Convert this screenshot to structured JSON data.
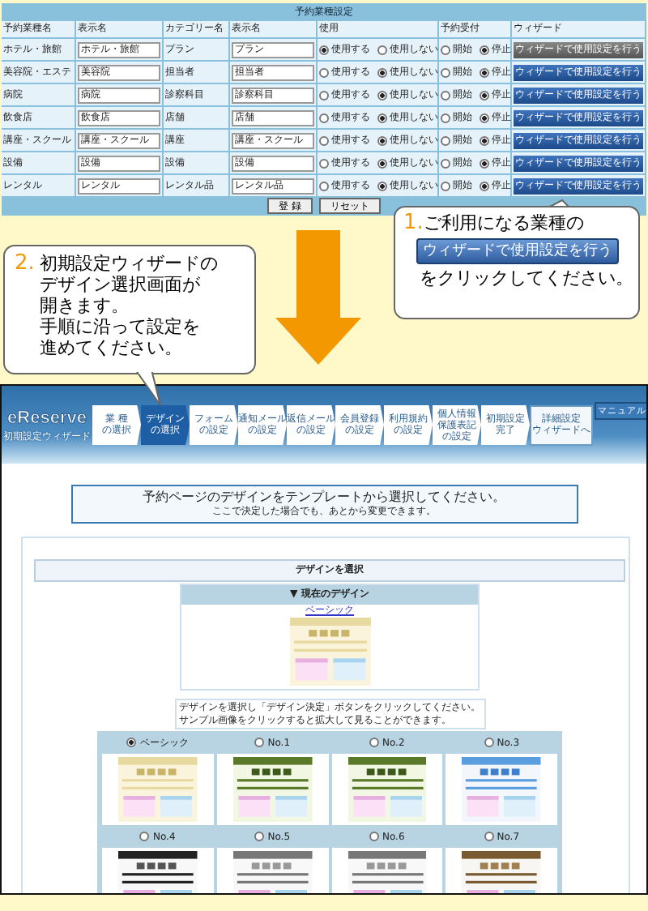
{
  "settings_table": {
    "title": "予約業種設定",
    "columns": [
      "予約業種名",
      "表示名",
      "カテゴリー名",
      "表示名",
      "使用",
      "予約受付",
      "ウィザード"
    ],
    "rows": [
      {
        "name": "ホテル・旅館",
        "display": "ホテル・旅館",
        "category": "プラン",
        "category_display": "プラン",
        "use": [
          {
            "label": "使用する",
            "selected": true
          },
          {
            "label": "使用しない",
            "selected": false
          }
        ],
        "accept": [
          {
            "label": "開始",
            "selected": false
          },
          {
            "label": "停止",
            "selected": true
          }
        ],
        "wizard": {
          "label": "ウィザードで使用設定を行う",
          "disabled": true
        }
      },
      {
        "name": "美容院・エステ",
        "display": "美容院",
        "category": "担当者",
        "category_display": "担当者",
        "use": [
          {
            "label": "使用する",
            "selected": false
          },
          {
            "label": "使用しない",
            "selected": true
          }
        ],
        "accept": [
          {
            "label": "開始",
            "selected": false
          },
          {
            "label": "停止",
            "selected": true
          }
        ],
        "wizard": {
          "label": "ウィザードで使用設定を行う",
          "disabled": false
        }
      },
      {
        "name": "病院",
        "display": "病院",
        "category": "診察科目",
        "category_display": "診察科目",
        "use": [
          {
            "label": "使用する",
            "selected": false
          },
          {
            "label": "使用しない",
            "selected": true
          }
        ],
        "accept": [
          {
            "label": "開始",
            "selected": false
          },
          {
            "label": "停止",
            "selected": true
          }
        ],
        "wizard": {
          "label": "ウィザードで使用設定を行う",
          "disabled": false
        }
      },
      {
        "name": "飲食店",
        "display": "飲食店",
        "category": "店舗",
        "category_display": "店舗",
        "use": [
          {
            "label": "使用する",
            "selected": false
          },
          {
            "label": "使用しない",
            "selected": true
          }
        ],
        "accept": [
          {
            "label": "開始",
            "selected": false
          },
          {
            "label": "停止",
            "selected": true
          }
        ],
        "wizard": {
          "label": "ウィザードで使用設定を行う",
          "disabled": false
        }
      },
      {
        "name": "講座・スクール",
        "display": "講座・スクール",
        "category": "講座",
        "category_display": "講座・スクール",
        "use": [
          {
            "label": "使用する",
            "selected": false
          },
          {
            "label": "使用しない",
            "selected": true
          }
        ],
        "accept": [
          {
            "label": "開始",
            "selected": false
          },
          {
            "label": "停止",
            "selected": true
          }
        ],
        "wizard": {
          "label": "ウィザードで使用設定を行う",
          "disabled": false
        }
      },
      {
        "name": "設備",
        "display": "設備",
        "category": "設備",
        "category_display": "設備",
        "use": [
          {
            "label": "使用する",
            "selected": false
          },
          {
            "label": "使用しない",
            "selected": true
          }
        ],
        "accept": [
          {
            "label": "開始",
            "selected": false
          },
          {
            "label": "停止",
            "selected": true
          }
        ],
        "wizard": {
          "label": "ウィザードで使用設定を行う",
          "disabled": false
        }
      },
      {
        "name": "レンタル",
        "display": "レンタル",
        "category": "レンタル品",
        "category_display": "レンタル品",
        "use": [
          {
            "label": "使用する",
            "selected": false
          },
          {
            "label": "使用しない",
            "selected": true
          }
        ],
        "accept": [
          {
            "label": "開始",
            "selected": false
          },
          {
            "label": "停止",
            "selected": true
          }
        ],
        "wizard": {
          "label": "ウィザードで使用設定を行う",
          "disabled": false
        }
      }
    ],
    "buttons": [
      "登 録",
      "リセット"
    ]
  },
  "callout_1": {
    "number": "1.",
    "line_1": "ご利用になる業種の",
    "button": "ウィザードで使用設定を行う",
    "line_2": "をクリックしてください。"
  },
  "callout_2": {
    "number": "2.",
    "lines": [
      "初期設定ウィザードの",
      "デザイン選択画面が",
      "開きます。",
      "手順に沿って設定を",
      "進めてください。"
    ]
  },
  "wizard_screen": {
    "logo": "eReserve",
    "subtitle": "初期設定ウィザード",
    "steps": [
      {
        "lines": [
          "業 種",
          "の選択"
        ],
        "kind": "step",
        "selected": false
      },
      {
        "lines": [
          "デザイン",
          "の選択"
        ],
        "kind": "step",
        "selected": true
      },
      {
        "lines": [
          "フォーム",
          "の設定"
        ],
        "kind": "step",
        "selected": false
      },
      {
        "lines": [
          "通知メール",
          "の設定"
        ],
        "kind": "step",
        "selected": false
      },
      {
        "lines": [
          "返信メール",
          "の設定"
        ],
        "kind": "step",
        "selected": false
      },
      {
        "lines": [
          "会員登録",
          "の設定"
        ],
        "kind": "step",
        "selected": false
      },
      {
        "lines": [
          "利用規約",
          "の設定"
        ],
        "kind": "step",
        "selected": false
      },
      {
        "lines": [
          "個人情報",
          "保護表記",
          "の設定"
        ],
        "kind": "step",
        "selected": false
      },
      {
        "lines": [
          "初期設定",
          "完了"
        ],
        "kind": "step",
        "selected": false
      },
      {
        "lines": [
          "詳細設定",
          "ウィザードへ"
        ],
        "kind": "link",
        "selected": false
      }
    ],
    "manual_button": "マニュアル",
    "notice": {
      "title": "予約ページのデザインをテンプレートから選択してください。",
      "note": "ここで決定した場合でも、あとから変更できます。"
    },
    "panel_title": "デザインを選択",
    "current_design": {
      "heading": "▼ 現在のデザイン",
      "link": "ベーシック"
    },
    "instructions": [
      "デザインを選択し「デザイン決定」ボタンをクリックしてください。",
      "サンプル画像をクリックすると拡大して見ることができます。"
    ],
    "designs": [
      {
        "label": "ベーシック",
        "selected": true
      },
      {
        "label": "No.1",
        "selected": false
      },
      {
        "label": "No.2",
        "selected": false
      },
      {
        "label": "No.3",
        "selected": false
      },
      {
        "label": "No.4",
        "selected": false
      },
      {
        "label": "No.5",
        "selected": false
      },
      {
        "label": "No.6",
        "selected": false
      },
      {
        "label": "No.7",
        "selected": false
      }
    ]
  }
}
